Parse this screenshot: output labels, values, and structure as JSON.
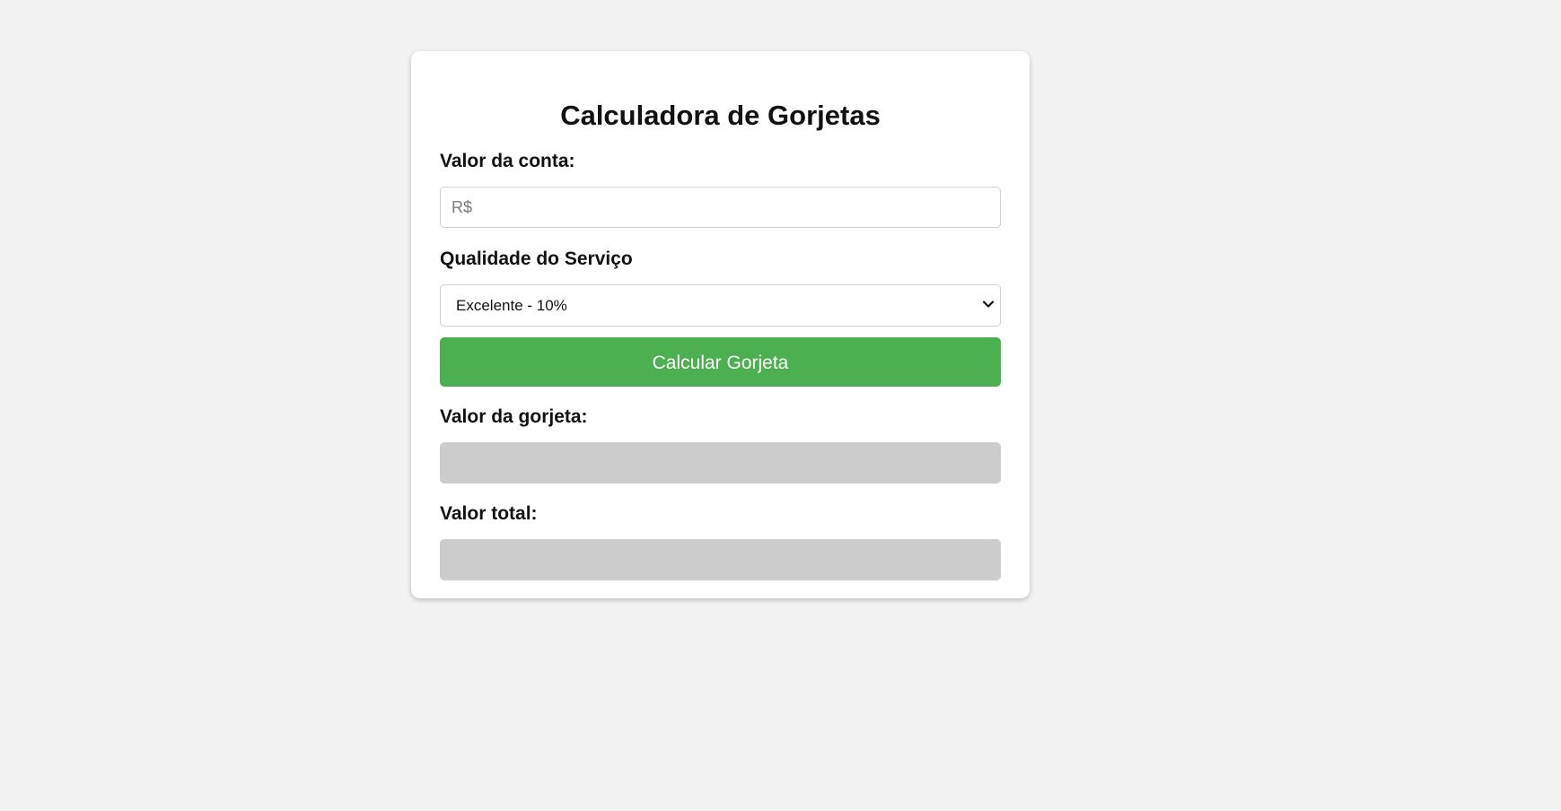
{
  "calculator": {
    "title": "Calculadora de Gorjetas",
    "bill_label": "Valor da conta:",
    "bill_placeholder": "R$",
    "bill_value": "",
    "quality_label": "Qualidade do Serviço",
    "quality_selected": "Excelente - 10%",
    "button_label": "Calcular Gorjeta",
    "tip_label": "Valor da gorjeta:",
    "tip_value": "",
    "total_label": "Valor total:",
    "total_value": ""
  },
  "colors": {
    "background": "#f2f2f2",
    "card": "#ffffff",
    "button": "#4caf50",
    "output_field": "#cccccc"
  },
  "icons": {
    "select_arrow": "chevron-down-icon"
  }
}
